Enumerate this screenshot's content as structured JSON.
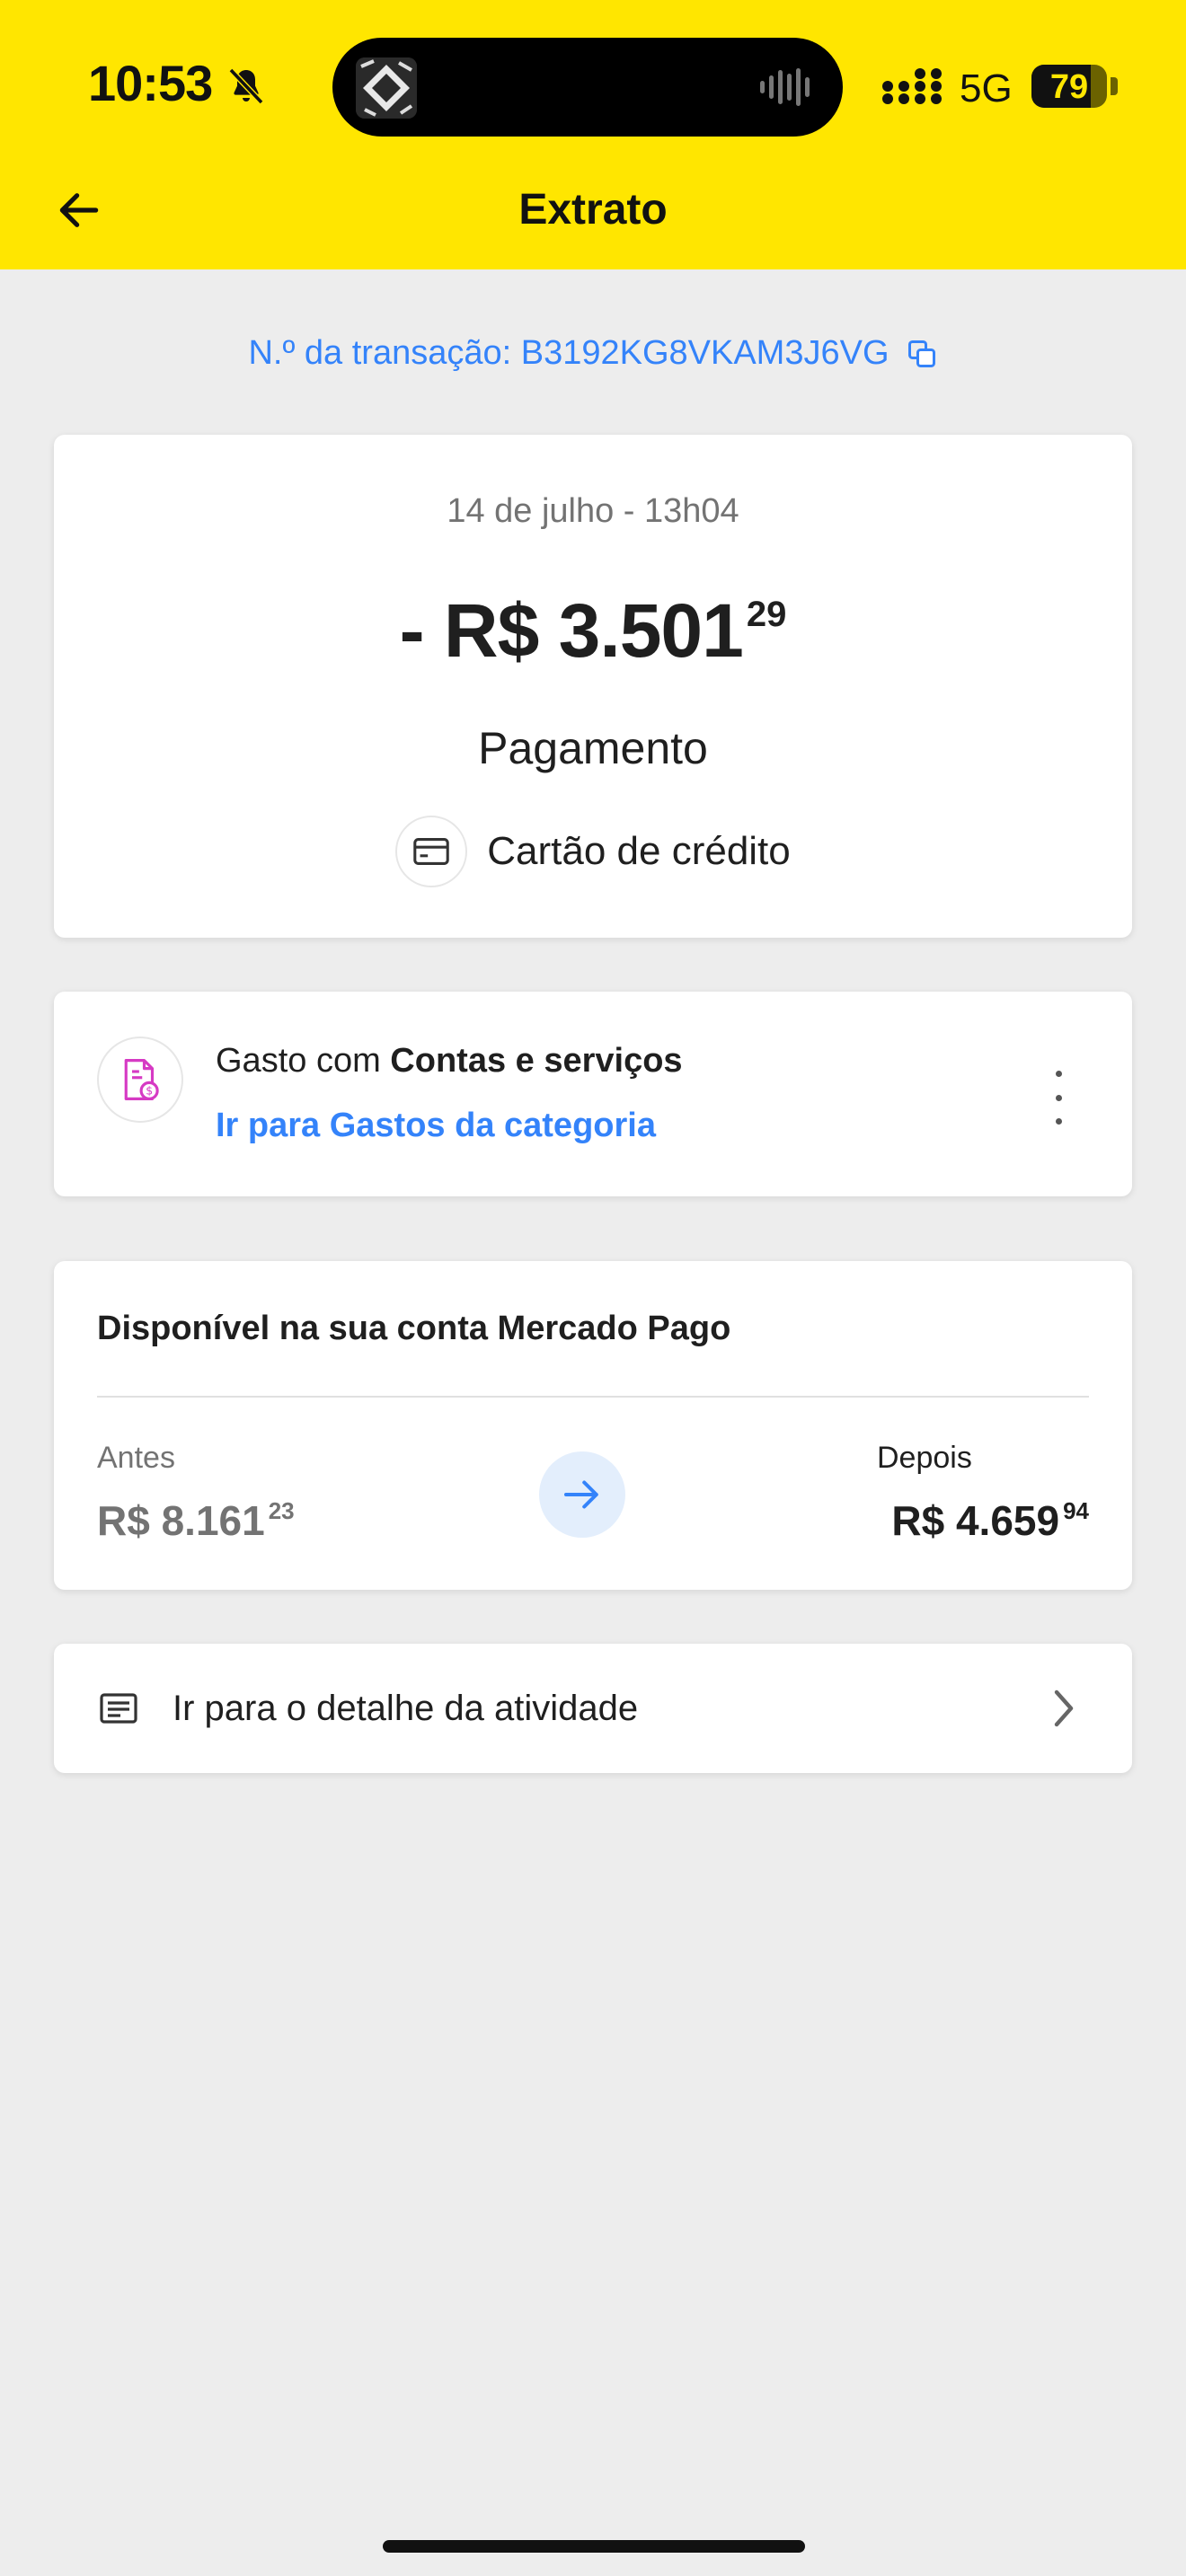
{
  "status_bar": {
    "time": "10:53",
    "network": "5G",
    "battery": "79",
    "battery_level": 0.79
  },
  "nav": {
    "title": "Extrato",
    "back_icon": "arrow-left-icon"
  },
  "transaction": {
    "number_label": "N.º da transação: B3192KG8VKAM3J6VG"
  },
  "summary": {
    "date_time": "14 de julho - 13h04",
    "amount_main": "- R$ 3.501",
    "amount_cents": "29",
    "operation": "Pagamento",
    "method": "Cartão de crédito"
  },
  "category": {
    "prefix": "Gasto com ",
    "name": "Contas e serviços",
    "link": "Ir para Gastos da categoria",
    "accent": "#d63ac4"
  },
  "balance": {
    "title": "Disponível na sua conta Mercado Pago",
    "before_label": "Antes",
    "before_main": "R$ 8.161",
    "before_cents": "23",
    "after_label": "Depois",
    "after_main": "R$ 4.659",
    "after_cents": "94"
  },
  "detail": {
    "label": "Ir para o detalhe da atividade"
  },
  "colors": {
    "brand_yellow": "#ffe600",
    "link_blue": "#3483fa",
    "background": "#ededed"
  }
}
